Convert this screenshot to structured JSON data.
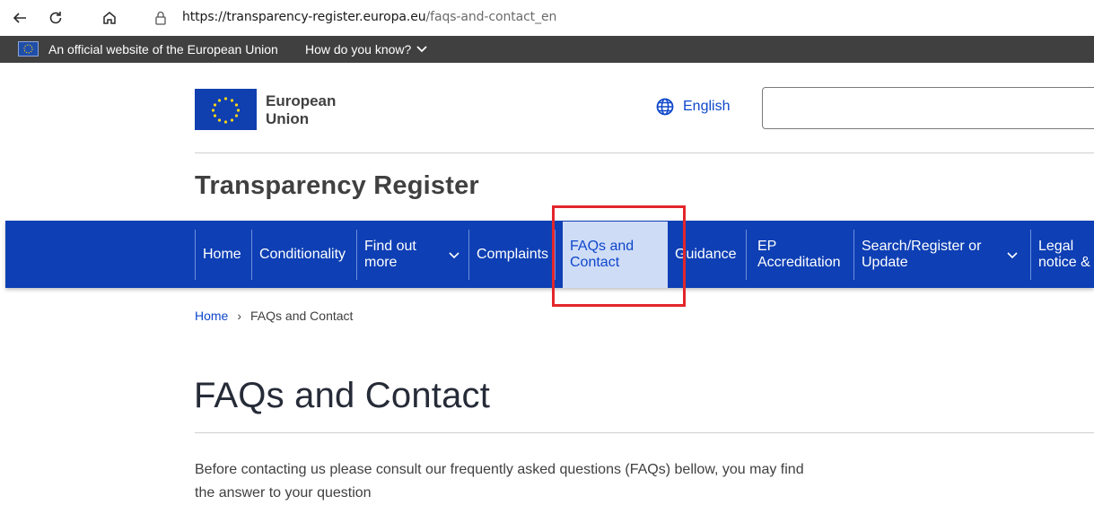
{
  "browser": {
    "url_host": "https://transparency-register.europa.eu",
    "url_path": "/faqs-and-contact_en"
  },
  "official_banner": {
    "text": "An official website of the European Union",
    "how_do_you_know": "How do you know?"
  },
  "header": {
    "logo_line1": "European",
    "logo_line2": "Union",
    "language": "English",
    "site_title": "Transparency Register"
  },
  "nav": {
    "items": [
      {
        "label": "Home"
      },
      {
        "label": "Conditionality"
      },
      {
        "label": "Find out more"
      },
      {
        "label": "Complaints"
      },
      {
        "label": "FAQs and Contact"
      },
      {
        "label": "Guidance"
      },
      {
        "label": "EP Accreditation"
      },
      {
        "label": "Search/Register or Update"
      },
      {
        "label": "Legal notice & data protection"
      }
    ]
  },
  "breadcrumb": {
    "home": "Home",
    "separator": "›",
    "current": "FAQs and Contact"
  },
  "page": {
    "title": "FAQs and Contact",
    "intro": "Before contacting us please consult our frequently asked questions (FAQs) bellow, you may find the answer to your question"
  },
  "colors": {
    "nav_background": "#0e3fb4",
    "nav_active_background": "#cfdcf6",
    "link": "#0e47cb",
    "highlight_box": "#e3262b",
    "official_bar": "#404040"
  }
}
